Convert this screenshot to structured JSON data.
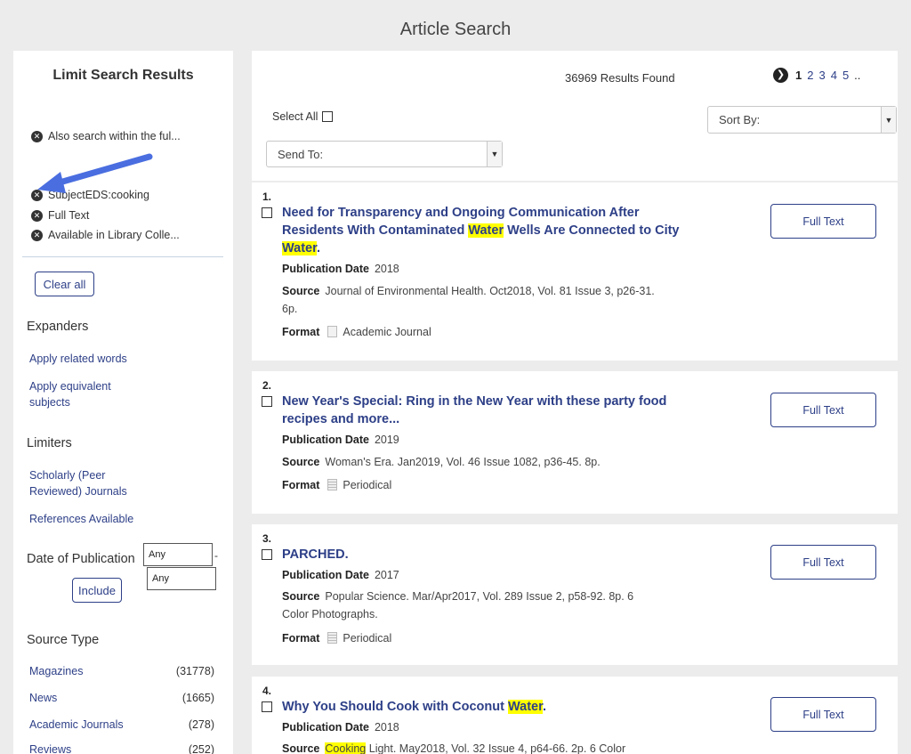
{
  "page": {
    "title": "Article Search"
  },
  "sidebar": {
    "title": "Limit Search Results",
    "applied_filters": [
      "Also search within the ful...",
      "SubjectEDS:cooking",
      "Full Text",
      "Available in Library Colle..."
    ],
    "clear_all_label": "Clear all",
    "expanders_heading": "Expanders",
    "expanders": [
      "Apply related words",
      "Apply equivalent subjects"
    ],
    "limiters_heading": "Limiters",
    "limiters": [
      "Scholarly (Peer Reviewed) Journals",
      "References Available"
    ],
    "date": {
      "label": "Date of Publication",
      "from_value": "Any",
      "to_value": "Any",
      "separator": "-",
      "include_label": "Include"
    },
    "source_type": {
      "heading": "Source Type",
      "items": [
        {
          "label": "Magazines",
          "count": "(31778)"
        },
        {
          "label": "News",
          "count": "(1665)"
        },
        {
          "label": "Academic Journals",
          "count": "(278)"
        },
        {
          "label": "Reviews",
          "count": "(252)"
        }
      ]
    }
  },
  "toolbar": {
    "results_count": "36969 Results Found",
    "pagination": {
      "next_icon": "chevron-right-circle-icon",
      "pages": [
        "1",
        "2",
        "3",
        "4",
        "5"
      ],
      "more": "..",
      "current": "1"
    },
    "select_all_label": "Select All",
    "sort_by_label": "Sort By:",
    "send_to_label": "Send To:"
  },
  "results": [
    {
      "number": "1.",
      "title_parts": [
        "Need for Transparency and Ongoing Communication After Residents With Contaminated ",
        "Water",
        " Wells Are Connected to City ",
        "Water",
        "."
      ],
      "pub_date_label": "Publication Date",
      "pub_date": "2018",
      "source_label": "Source",
      "source": "Journal of Environmental Health. Oct2018, Vol. 81 Issue 3, p26-31. 6p.",
      "format_label": "Format",
      "format": "Academic Journal",
      "full_text_label": "Full Text"
    },
    {
      "number": "2.",
      "title": "New Year's Special: Ring in the New Year with these party food recipes and more...",
      "pub_date_label": "Publication Date",
      "pub_date": "2019",
      "source_label": "Source",
      "source": "Woman's Era. Jan2019, Vol. 46 Issue 1082, p36-45. 8p.",
      "format_label": "Format",
      "format": "Periodical",
      "full_text_label": "Full Text"
    },
    {
      "number": "3.",
      "title": "PARCHED.",
      "pub_date_label": "Publication Date",
      "pub_date": "2017",
      "source_label": "Source",
      "source": "Popular Science. Mar/Apr2017, Vol. 289 Issue 2, p58-92. 8p. 6 Color Photographs.",
      "format_label": "Format",
      "format": "Periodical",
      "full_text_label": "Full Text"
    },
    {
      "number": "4.",
      "title_parts": [
        "Why You Should Cook with Coconut ",
        "Water",
        "."
      ],
      "pub_date_label": "Publication Date",
      "pub_date": "2018",
      "source_label": "Source",
      "source_parts": [
        "Cooking",
        " Light. May2018, Vol. 32 Issue 4, p64-66. 2p. 6 Color"
      ],
      "full_text_label": "Full Text"
    }
  ],
  "colors": {
    "link": "#2d3f87",
    "highlight": "#ffff00",
    "annotation_arrow": "#4a6ee0"
  }
}
